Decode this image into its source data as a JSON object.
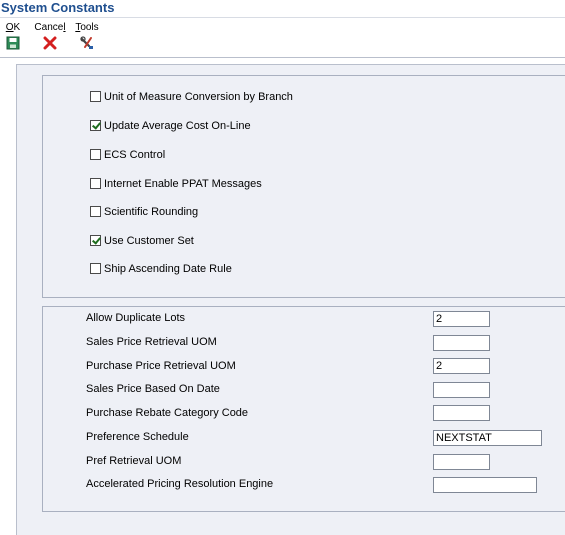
{
  "window": {
    "title": "System Constants"
  },
  "toolbar": {
    "ok": {
      "label_mn": "O",
      "label_rest": "K",
      "icon": "save-icon"
    },
    "cancel": {
      "label_pre": "Cance",
      "label_mn": "l",
      "icon": "cancel-x-icon"
    },
    "tools": {
      "label_mn": "T",
      "label_rest": "ools",
      "icon": "tools-icon"
    }
  },
  "checkboxes": [
    {
      "label": "Unit of Measure Conversion by Branch",
      "checked": false
    },
    {
      "label": "Update Average Cost On-Line",
      "checked": true
    },
    {
      "label": "ECS Control",
      "checked": false
    },
    {
      "label": "Internet Enable PPAT Messages",
      "checked": false
    },
    {
      "label": "Scientific Rounding",
      "checked": false
    },
    {
      "label": "Use Customer Set",
      "checked": true
    },
    {
      "label": "Ship Ascending Date Rule",
      "checked": false
    }
  ],
  "fields": [
    {
      "label": "Allow Duplicate Lots",
      "value": "2"
    },
    {
      "label": "Sales Price Retrieval UOM",
      "value": ""
    },
    {
      "label": "Purchase Price Retrieval UOM",
      "value": "2"
    },
    {
      "label": "Sales Price Based On Date",
      "value": ""
    },
    {
      "label": "Purchase Rebate Category Code",
      "value": ""
    },
    {
      "label": "Preference Schedule",
      "value": "NEXTSTAT"
    },
    {
      "label": "Pref Retrieval UOM",
      "value": ""
    },
    {
      "label": "Accelerated Pricing Resolution Engine",
      "value": ""
    }
  ]
}
